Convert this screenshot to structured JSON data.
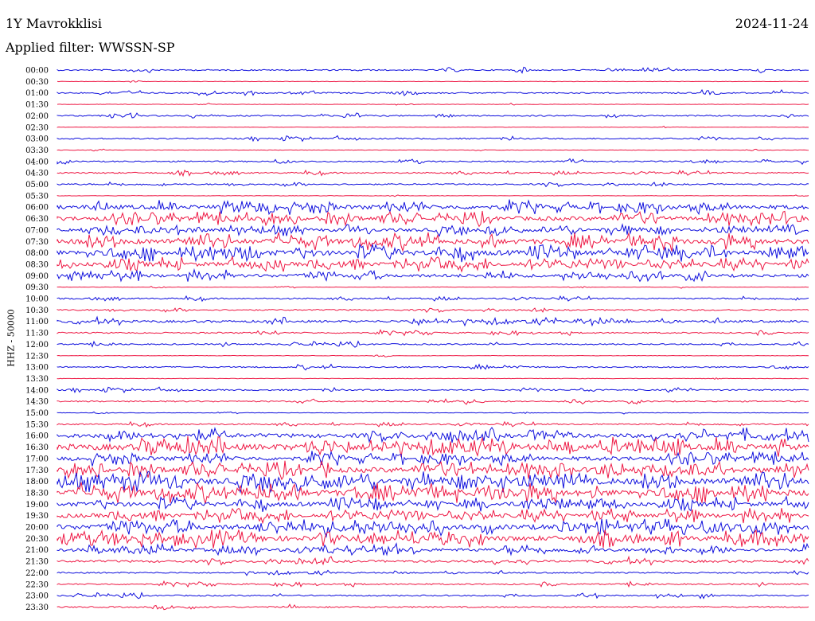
{
  "header": {
    "station": "1Y Mavrokklisi",
    "date": "2024-11-24",
    "filter": "Applied filter: WWSSN-SP"
  },
  "chart_data": {
    "type": "line",
    "title": "1Y Mavrokklisi",
    "ylabel": "HHZ - 50000",
    "colors": [
      "#1010dd",
      "#ee1844"
    ],
    "rows": [
      "00:00",
      "00:30",
      "01:00",
      "01:30",
      "02:00",
      "02:30",
      "03:00",
      "03:30",
      "04:00",
      "04:30",
      "05:00",
      "05:30",
      "06:00",
      "06:30",
      "07:00",
      "07:30",
      "08:00",
      "08:30",
      "09:00",
      "09:30",
      "10:00",
      "10:30",
      "11:00",
      "11:30",
      "12:00",
      "12:30",
      "13:00",
      "13:30",
      "14:00",
      "14:30",
      "15:00",
      "15:30",
      "16:00",
      "16:30",
      "17:00",
      "17:30",
      "18:00",
      "18:30",
      "19:00",
      "19:30",
      "20:00",
      "20:30",
      "21:00",
      "21:30",
      "22:00",
      "22:30",
      "23:00",
      "23:30"
    ],
    "amplitude_level": [
      1,
      0,
      1,
      0,
      1,
      0,
      1,
      0,
      1,
      1,
      1,
      0,
      4,
      4,
      3,
      5,
      5,
      4,
      3,
      0,
      1,
      1,
      2,
      1,
      1,
      0,
      1,
      0,
      1,
      1,
      0,
      1,
      4,
      6,
      4,
      5,
      6,
      6,
      4,
      4,
      5,
      5,
      3,
      2,
      1,
      1,
      1,
      1
    ]
  }
}
